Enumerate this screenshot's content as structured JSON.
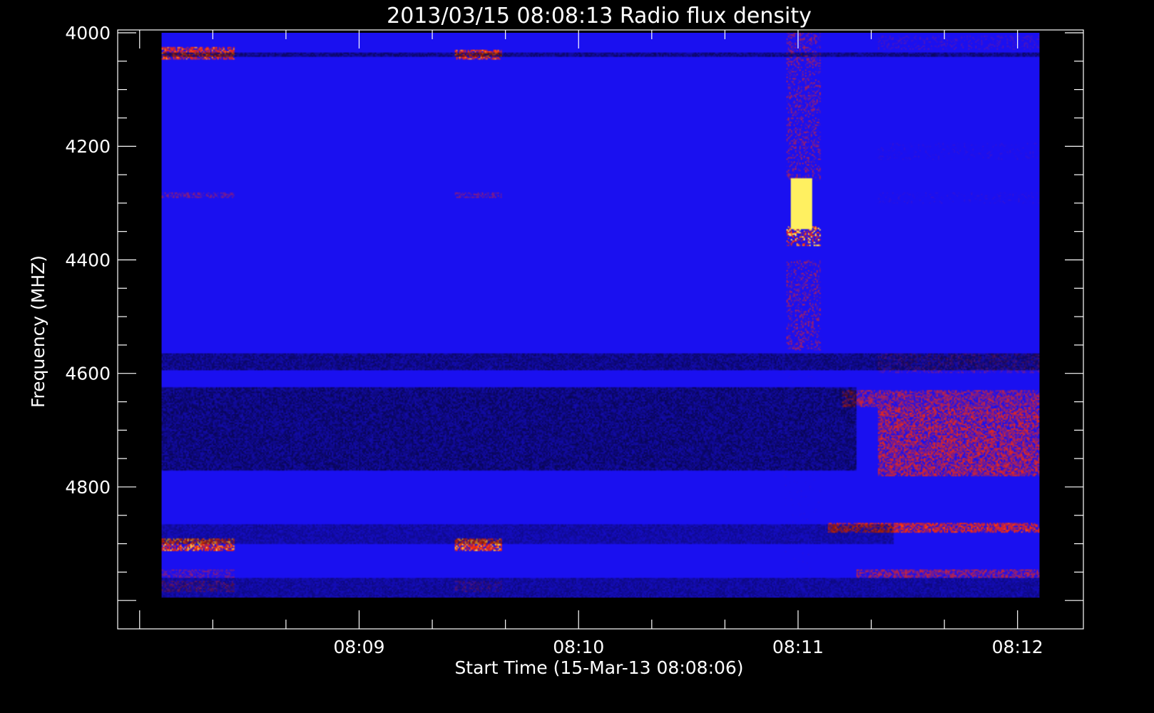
{
  "chart_data": {
    "type": "heatmap",
    "title": "2013/03/15 08:08:13 Radio flux density",
    "xlabel": "Start Time (15-Mar-13 08:08:06)",
    "ylabel": "Frequency (MHZ)",
    "x_tick_labels": [
      "08:09",
      "08:10",
      "08:11",
      "08:12"
    ],
    "x_tick_seconds": [
      54,
      114,
      174,
      234
    ],
    "x_range_seconds": [
      -12,
      252
    ],
    "x_data_range_seconds": [
      0,
      240
    ],
    "y_ticks": [
      4000,
      4200,
      4400,
      4600,
      4800
    ],
    "y_range": [
      3995,
      5050
    ],
    "y_data_range": [
      4000,
      4995
    ],
    "colors": {
      "background": "#000000",
      "foreground": "#ffffff",
      "low": "#1a10f0",
      "mid": "#ff2a00",
      "high": "#fff060"
    },
    "features": [
      {
        "kind": "burst",
        "t": [
          172,
          178
        ],
        "f": [
          4255,
          4345
        ],
        "intensity": 1.0
      },
      {
        "kind": "burst",
        "t": [
          171,
          180
        ],
        "f": [
          4340,
          4375
        ],
        "intensity": 0.85
      },
      {
        "kind": "burst",
        "t": [
          171,
          180
        ],
        "f": [
          4000,
          4260
        ],
        "intensity": 0.55
      },
      {
        "kind": "burst",
        "t": [
          171,
          180
        ],
        "f": [
          4400,
          4560
        ],
        "intensity": 0.55
      },
      {
        "kind": "burst",
        "t": [
          170,
          180
        ],
        "f": [
          4560,
          4980
        ],
        "intensity": 0.35
      },
      {
        "kind": "band",
        "t": [
          0,
          20
        ],
        "f": [
          4025,
          4048
        ],
        "intensity": 0.8
      },
      {
        "kind": "band",
        "t": [
          80,
          93
        ],
        "f": [
          4030,
          4048
        ],
        "intensity": 0.8
      },
      {
        "kind": "band",
        "t": [
          0,
          20
        ],
        "f": [
          4280,
          4292
        ],
        "intensity": 0.55
      },
      {
        "kind": "band",
        "t": [
          80,
          93
        ],
        "f": [
          4280,
          4292
        ],
        "intensity": 0.55
      },
      {
        "kind": "band",
        "t": [
          0,
          20
        ],
        "f": [
          4890,
          4912
        ],
        "intensity": 0.85
      },
      {
        "kind": "band",
        "t": [
          80,
          93
        ],
        "f": [
          4890,
          4912
        ],
        "intensity": 0.85
      },
      {
        "kind": "band",
        "t": [
          0,
          20
        ],
        "f": [
          4945,
          4960
        ],
        "intensity": 0.55
      },
      {
        "kind": "band",
        "t": [
          0,
          20
        ],
        "f": [
          4965,
          4985
        ],
        "intensity": 0.55
      },
      {
        "kind": "band",
        "t": [
          80,
          93
        ],
        "f": [
          4965,
          4985
        ],
        "intensity": 0.5
      },
      {
        "kind": "band",
        "t": [
          196,
          240
        ],
        "f": [
          4005,
          4030
        ],
        "intensity": 0.45
      },
      {
        "kind": "band",
        "t": [
          196,
          240
        ],
        "f": [
          4195,
          4225
        ],
        "intensity": 0.4
      },
      {
        "kind": "band",
        "t": [
          196,
          240
        ],
        "f": [
          4280,
          4300
        ],
        "intensity": 0.4
      },
      {
        "kind": "band",
        "t": [
          196,
          240
        ],
        "f": [
          4565,
          4600
        ],
        "intensity": 0.5
      },
      {
        "kind": "band",
        "t": [
          186,
          240
        ],
        "f": [
          4630,
          4660
        ],
        "intensity": 0.65
      },
      {
        "kind": "band",
        "t": [
          196,
          240
        ],
        "f": [
          4660,
          4780
        ],
        "intensity": 0.7
      },
      {
        "kind": "band",
        "t": [
          182,
          240
        ],
        "f": [
          4862,
          4880
        ],
        "intensity": 0.75
      },
      {
        "kind": "band",
        "t": [
          190,
          240
        ],
        "f": [
          4945,
          4960
        ],
        "intensity": 0.65
      },
      {
        "kind": "dark",
        "t": [
          0,
          240
        ],
        "f": [
          4565,
          4595
        ],
        "intensity": 0.5
      },
      {
        "kind": "dark",
        "t": [
          0,
          190
        ],
        "f": [
          4625,
          4770
        ],
        "intensity": 0.55
      },
      {
        "kind": "dark",
        "t": [
          0,
          240
        ],
        "f": [
          4035,
          4042
        ],
        "intensity": 0.5
      },
      {
        "kind": "dark",
        "t": [
          0,
          240
        ],
        "f": [
          4960,
          4995
        ],
        "intensity": 0.4
      },
      {
        "kind": "dark",
        "t": [
          0,
          200
        ],
        "f": [
          4865,
          4900
        ],
        "intensity": 0.35
      }
    ]
  }
}
